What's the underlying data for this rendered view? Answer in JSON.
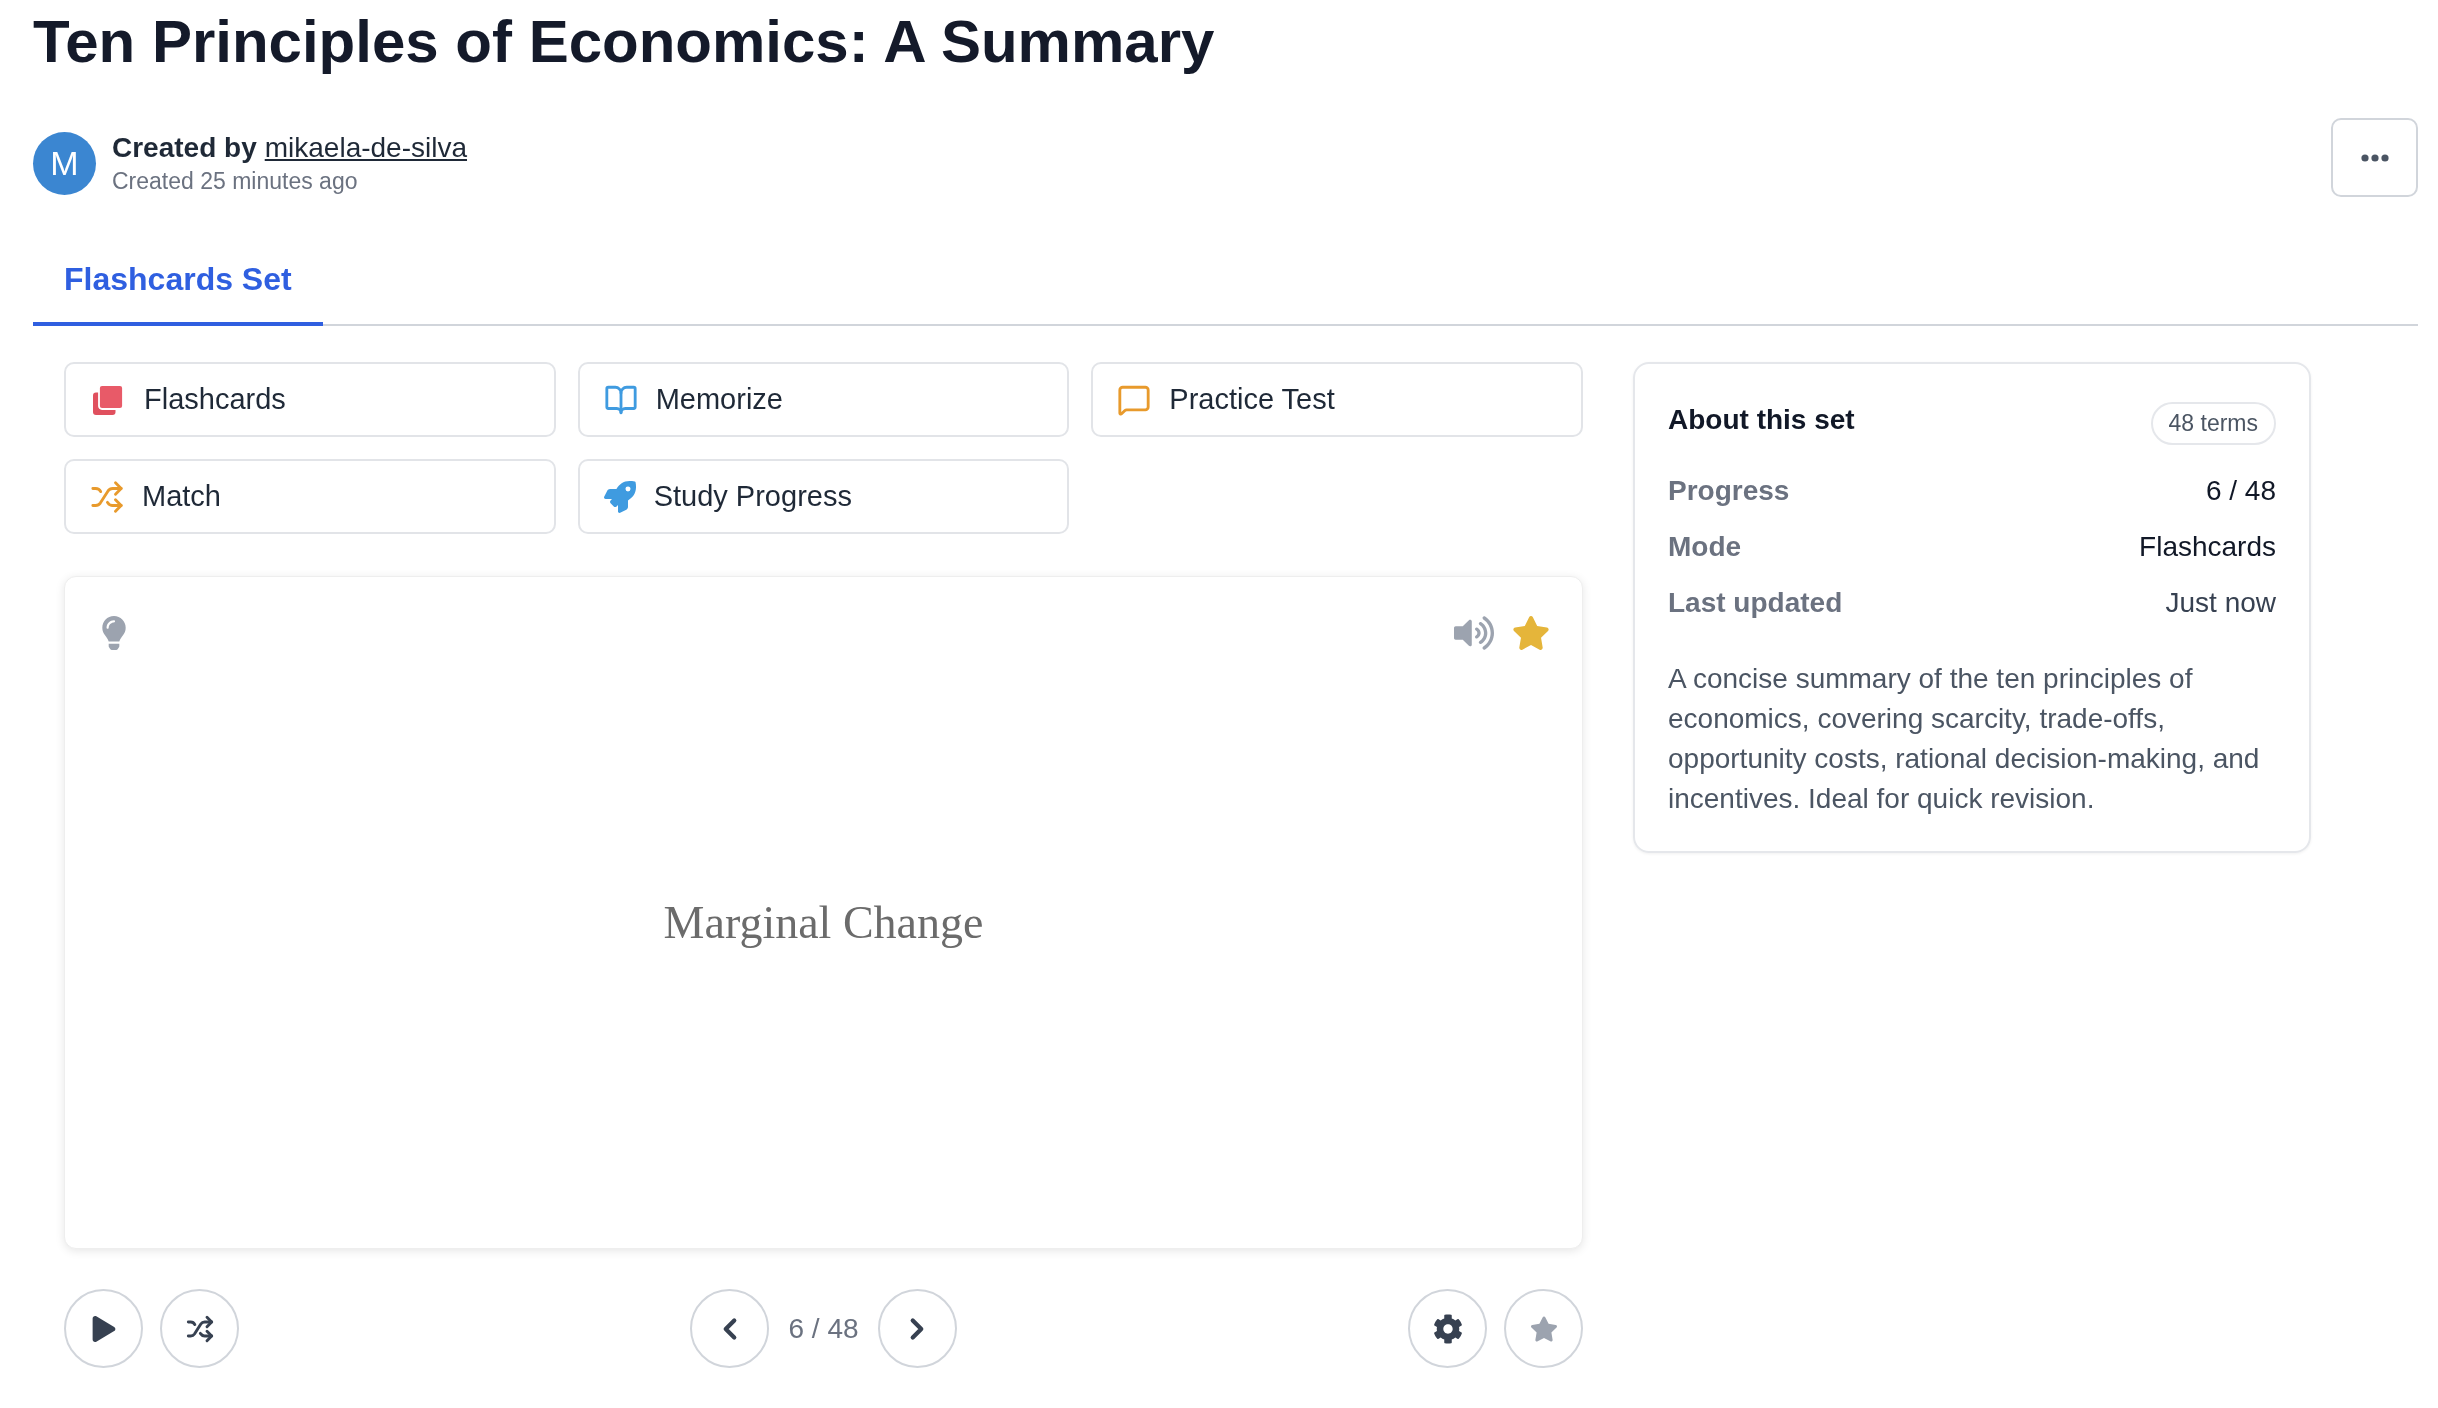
{
  "title": "Ten Principles of Economics: A Summary",
  "author": {
    "avatar_letter": "M",
    "prefix": "Created by",
    "username": "mikaela-de-silva",
    "created": "Created 25 minutes ago"
  },
  "tabs": [
    {
      "label": "Flashcards Set",
      "selected": true
    }
  ],
  "modes": [
    {
      "label": "Flashcards",
      "kind": "flashcards"
    },
    {
      "label": "Memorize",
      "kind": "memorize"
    },
    {
      "label": "Practice Test",
      "kind": "test"
    },
    {
      "label": "Match",
      "kind": "match"
    },
    {
      "label": "Study Progress",
      "kind": "progress"
    }
  ],
  "card": {
    "term": "Marginal Change",
    "starred": true
  },
  "controls": {
    "counter": "6 / 48"
  },
  "about": {
    "title": "About this set",
    "badge": "48 terms",
    "rows": [
      {
        "label": "Progress",
        "value": "6 / 48",
        "strong": true
      },
      {
        "label": "Mode",
        "value": "Flashcards",
        "strong": true
      },
      {
        "label": "Last updated",
        "value": "Just now",
        "strong": false
      }
    ],
    "description": "A concise summary of the ten principles of economics, covering scarcity, trade-offs, opportunity costs, rational decision-making, and incentives. Ideal for quick revision."
  }
}
